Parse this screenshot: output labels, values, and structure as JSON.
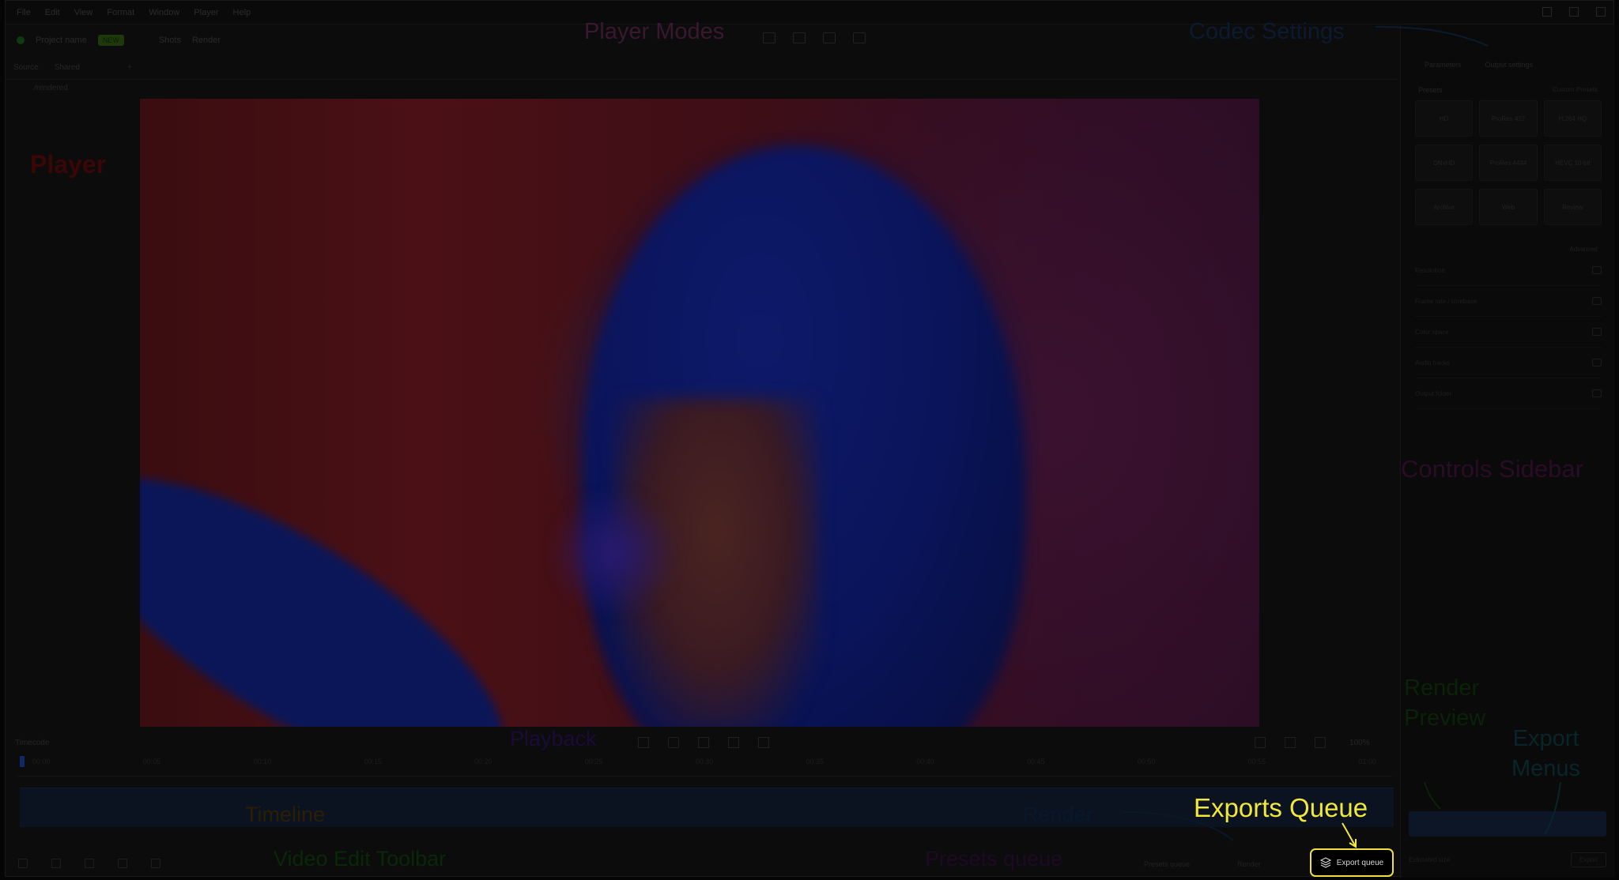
{
  "menubar": {
    "items": [
      "File",
      "Edit",
      "View",
      "Format",
      "Window",
      "Player",
      "Help"
    ]
  },
  "toolbar": {
    "project_label": "Project name",
    "badge": "NEW",
    "item_a": "Shots",
    "item_b": "Render"
  },
  "subbar": {
    "item_a": "Source",
    "item_b": "Shared",
    "item_c": "+"
  },
  "pathbar": {
    "path": "/rendered"
  },
  "sidebar": {
    "tab_a": "Parameters",
    "tab_b": "Output settings",
    "presets_title": "Presets",
    "presets_right": "Custom Presets",
    "presets": [
      "HD",
      "ProRes 422",
      "H.264 HQ",
      "DNxHD",
      "ProRes 4444",
      "HEVC 10-bit",
      "Archive",
      "Web",
      "Review"
    ],
    "advanced_label": "Advanced",
    "rows": [
      "Resolution",
      "Frame rate / timebase",
      "Color space",
      "Audio tracks",
      "Output folder"
    ],
    "bottom_left": "Estimated size",
    "export_button": "Export"
  },
  "playback": {
    "label": "Timecode",
    "zoom": "100%"
  },
  "ruler": {
    "ticks": [
      "00:00",
      "00:05",
      "00:10",
      "00:15",
      "00:20",
      "00:25",
      "00:30",
      "00:35",
      "00:40",
      "00:45",
      "00:50",
      "00:55",
      "01:00"
    ]
  },
  "edit_toolbar": {
    "presets_queue": "Presets queue",
    "render": "Render"
  },
  "export_queue": {
    "label": "Export queue"
  },
  "annotations": {
    "player_modes": "Player Modes",
    "codec_settings": "Codec Settings",
    "player": "Player",
    "controls_sidebar": "Controls Sidebar",
    "render_preview_1": "Render",
    "render_preview_2": "Preview",
    "export_menus_1": "Export",
    "export_menus_2": "Menus",
    "playback": "Playback",
    "timeline": "Timeline",
    "render_btn": "Render",
    "video_edit_toolbar": "Video Edit Toolbar",
    "presets_queue": "Presets queue",
    "exports_queue": "Exports Queue"
  },
  "colors": {
    "highlight": "#f0e03a",
    "annotation_text": "#f2e83a"
  }
}
